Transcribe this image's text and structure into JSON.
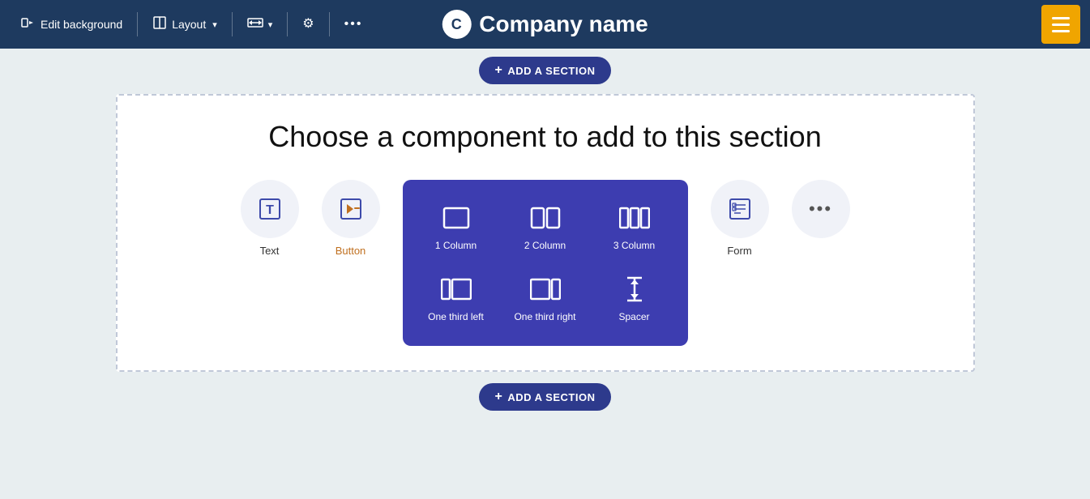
{
  "toolbar": {
    "edit_background_label": "Edit background",
    "layout_label": "Layout",
    "add_section_label": "ADD A SECTION",
    "company_name": "Company name"
  },
  "section": {
    "title": "Choose a component to add to this section",
    "components": [
      {
        "id": "text",
        "label": "Text",
        "icon": "T",
        "color": "normal"
      },
      {
        "id": "button",
        "label": "Button",
        "icon": "cursor",
        "color": "orange"
      }
    ],
    "more_label": "..."
  },
  "layout_dropdown": {
    "items": [
      {
        "id": "one-column",
        "label": "1 Column"
      },
      {
        "id": "two-column",
        "label": "2 Column"
      },
      {
        "id": "three-column",
        "label": "3 Column"
      },
      {
        "id": "one-third-left",
        "label": "One third left"
      },
      {
        "id": "one-third-right",
        "label": "One third right"
      },
      {
        "id": "spacer",
        "label": "Spacer"
      }
    ]
  },
  "right_section": {
    "form_label": "Form"
  },
  "colors": {
    "toolbar_bg": "#1e3a5f",
    "dropdown_bg": "#3d3db0",
    "add_section_bg": "#2d3a8c",
    "accent_orange": "#f0a500"
  }
}
